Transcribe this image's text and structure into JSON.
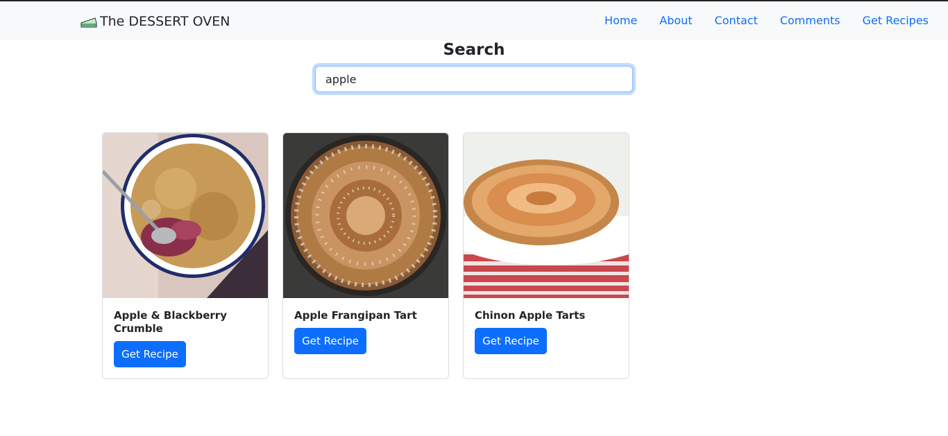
{
  "navbar": {
    "brand": "The DESSERT OVEN",
    "brand_icon": "cake-slice-icon",
    "links": [
      "Home",
      "About",
      "Contact",
      "Comments",
      "Get Recipes"
    ]
  },
  "search": {
    "title": "Search",
    "value": "apple"
  },
  "results": [
    {
      "title": "Apple & Blackberry Crumble",
      "button": "Get Recipe",
      "image": "crumble-photo"
    },
    {
      "title": "Apple Frangipan Tart",
      "button": "Get Recipe",
      "image": "frangipan-tart-photo"
    },
    {
      "title": "Chinon Apple Tarts",
      "button": "Get Recipe",
      "image": "apple-tart-photo"
    }
  ],
  "colors": {
    "primary": "#0d6efd",
    "navbar_bg": "#f8f9fa",
    "text": "#212529"
  }
}
